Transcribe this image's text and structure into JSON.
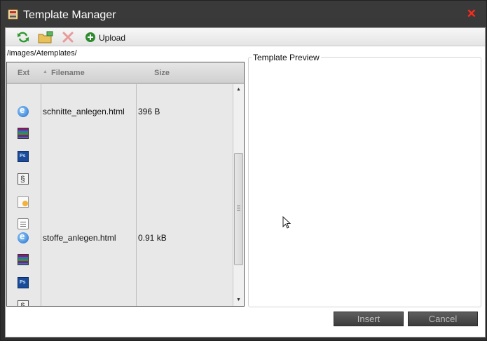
{
  "window": {
    "title": "Template Manager"
  },
  "toolbar": {
    "refresh_icon": "refresh-icon",
    "new_folder_icon": "new-folder-icon",
    "delete_icon": "delete-icon",
    "upload_label": "Upload"
  },
  "path": "/images/Atemplates/",
  "file_list": {
    "headers": {
      "ext": "Ext",
      "filename": "Filename",
      "size": "Size"
    },
    "rows": [
      {
        "icon": "internet-explorer-icon",
        "filename": "schnitte_anlegen.html",
        "size": "396 B"
      },
      {
        "icon": "winrar-archive-icon",
        "filename": "",
        "size": ""
      },
      {
        "icon": "photoshop-file-icon",
        "filename": "",
        "size": ""
      },
      {
        "icon": "generic-file-icon",
        "filename": "",
        "size": ""
      },
      {
        "icon": "document-file-icon",
        "filename": "",
        "size": ""
      },
      {
        "icon": "notepad-file-icon",
        "filename": "",
        "size": ""
      },
      {
        "icon": "internet-explorer-icon",
        "filename": "stoffe_anlegen.html",
        "size": "0.91 kB"
      },
      {
        "icon": "winrar-archive-icon",
        "filename": "",
        "size": ""
      },
      {
        "icon": "photoshop-file-icon",
        "filename": "",
        "size": ""
      },
      {
        "icon": "generic-file-icon",
        "filename": "",
        "size": ""
      }
    ]
  },
  "preview": {
    "legend": "Template Preview"
  },
  "buttons": {
    "insert": "Insert",
    "cancel": "Cancel"
  },
  "colors": {
    "titlebar": "#333333",
    "close": "#ff2a1a",
    "button_bg": "#4a4a4a"
  }
}
